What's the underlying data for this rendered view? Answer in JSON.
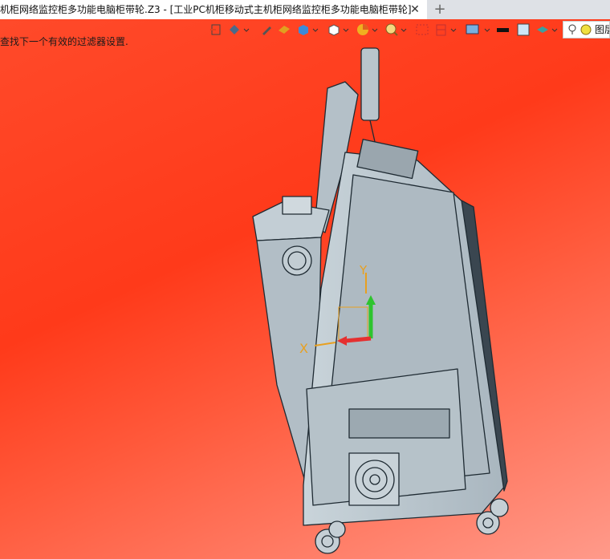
{
  "tab": {
    "title": "机柜网络监控柜多功能电脑柜带轮.Z3 - [工业PC机柜移动式主机柜网络监控柜多功能电脑柜带轮]",
    "close_glyph": "✕",
    "new_tab_glyph": "+"
  },
  "status": {
    "message": "查找下一个有效的过滤器设置."
  },
  "toolbar": {
    "items": [
      {
        "icon": "exit-sketch-icon",
        "dropdown": false
      },
      {
        "icon": "render-mode-icon",
        "dropdown": true
      },
      {
        "icon": "pen-icon",
        "dropdown": false
      },
      {
        "icon": "eraser-icon",
        "dropdown": false
      },
      {
        "icon": "shaded-box-icon",
        "dropdown": true
      },
      {
        "icon": "view-cube-icon",
        "dropdown": true
      },
      {
        "icon": "pie-filter-icon",
        "dropdown": true
      },
      {
        "icon": "zoom-icon",
        "dropdown": true
      },
      {
        "icon": "capture-icon",
        "dropdown": false
      },
      {
        "icon": "section-plane-icon",
        "dropdown": true
      },
      {
        "icon": "display-settings-icon",
        "dropdown": true
      },
      {
        "icon": "line-color-icon",
        "dropdown": false
      },
      {
        "icon": "face-color-icon",
        "dropdown": false
      },
      {
        "icon": "layer-style-icon",
        "dropdown": true
      }
    ]
  },
  "layers": {
    "label": "图层"
  },
  "axes": {
    "x_label": "X",
    "y_label": "Y"
  },
  "colors": {
    "viewport_top": "#ff3a1a",
    "viewport_bottom": "#ff9a8a",
    "model_fill": "#b8c4cc",
    "model_edge": "#1e2a32",
    "x_axis": "#e53030",
    "y_axis": "#2ec42e",
    "axis_label": "#e8a020"
  }
}
